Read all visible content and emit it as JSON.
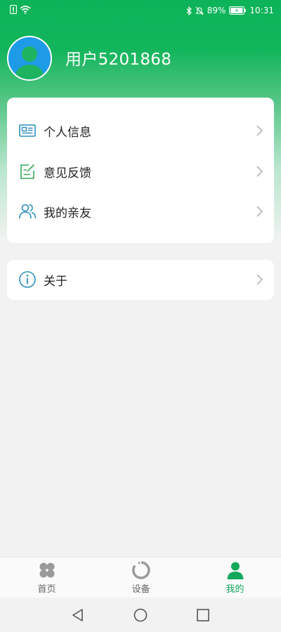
{
  "status_bar": {
    "battery": "89%",
    "time": "10:31"
  },
  "profile": {
    "username": "用户5201868"
  },
  "menu_card": {
    "items": [
      {
        "label": "个人信息",
        "icon": "id-card-icon"
      },
      {
        "label": "意见反馈",
        "icon": "feedback-edit-icon"
      },
      {
        "label": "我的亲友",
        "icon": "users-icon"
      }
    ]
  },
  "about_card": {
    "label": "关于",
    "icon": "info-icon"
  },
  "bottom_nav": {
    "items": [
      {
        "label": "首页",
        "icon": "clover-icon",
        "active": false
      },
      {
        "label": "设备",
        "icon": "device-ring-icon",
        "active": false
      },
      {
        "label": "我的",
        "icon": "person-icon",
        "active": true
      }
    ]
  },
  "colors": {
    "primary_green": "#13a95c",
    "header_green": "#0cb358",
    "icon_teal": "#2a8fbd",
    "icon_green": "#3aa85a"
  }
}
